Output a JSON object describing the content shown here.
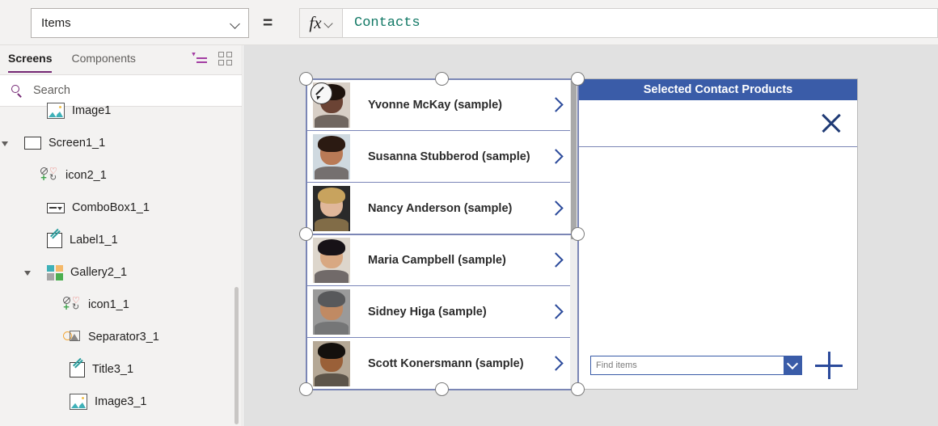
{
  "formula_bar": {
    "property_label": "Items",
    "equals": "=",
    "fx_label": "fx",
    "formula_value": "Contacts"
  },
  "sidebar": {
    "tabs": [
      {
        "label": "Screens",
        "active": true
      },
      {
        "label": "Components",
        "active": false
      }
    ],
    "view_icons": [
      "tree-view-icon",
      "grid-view-icon"
    ],
    "search": {
      "placeholder": "Search"
    },
    "tree": [
      {
        "label": "Image1",
        "icon": "image-icon",
        "indent": 58,
        "expander": "none"
      },
      {
        "label": "Screen1_1",
        "icon": "screen-icon",
        "indent": 30,
        "expander": "open"
      },
      {
        "label": "icon2_1",
        "icon": "iconset-icon",
        "indent": 50,
        "expander": "none"
      },
      {
        "label": "ComboBox1_1",
        "icon": "combobox-icon",
        "indent": 58,
        "expander": "none"
      },
      {
        "label": "Label1_1",
        "icon": "label-icon",
        "indent": 58,
        "expander": "none"
      },
      {
        "label": "Gallery2_1",
        "icon": "gallery-icon",
        "indent": 58,
        "expander": "open"
      },
      {
        "label": "icon1_1",
        "icon": "iconset-icon",
        "indent": 78,
        "expander": "none"
      },
      {
        "label": "Separator3_1",
        "icon": "separator-icon",
        "indent": 78,
        "expander": "none"
      },
      {
        "label": "Title3_1",
        "icon": "label-icon",
        "indent": 86,
        "expander": "none"
      },
      {
        "label": "Image3_1",
        "icon": "image-icon",
        "indent": 86,
        "expander": "none"
      }
    ]
  },
  "canvas": {
    "gallery": {
      "rows": [
        {
          "name": "Yvonne McKay (sample)",
          "skin": "#6b4334",
          "hair": "#1d120c",
          "bg": "#d8cfc6",
          "selected": true
        },
        {
          "name": "Susanna Stubberod (sample)",
          "skin": "#b97a56",
          "hair": "#2b1a12",
          "bg": "#cfd9e0"
        },
        {
          "name": "Nancy Anderson (sample)",
          "skin": "#e0b79a",
          "hair": "#c8a35e",
          "bg": "#2a2a2a"
        },
        {
          "name": "Maria Campbell (sample)",
          "skin": "#d8a882",
          "hair": "#171217",
          "bg": "#ddd6cc"
        },
        {
          "name": "Sidney Higa (sample)",
          "skin": "#c08a63",
          "hair": "#58595b",
          "bg": "#9a9a9a"
        },
        {
          "name": "Scott Konersmann (sample)",
          "skin": "#9a6038",
          "hair": "#14100d",
          "bg": "#b5a896"
        }
      ],
      "edit_badge": "edit-pencil-icon"
    },
    "panel": {
      "title": "Selected Contact Products",
      "close_icon": "close-icon",
      "find_items": {
        "placeholder": "Find items"
      },
      "add_icon": "plus-icon",
      "header_color": "#3a5ca8"
    }
  }
}
